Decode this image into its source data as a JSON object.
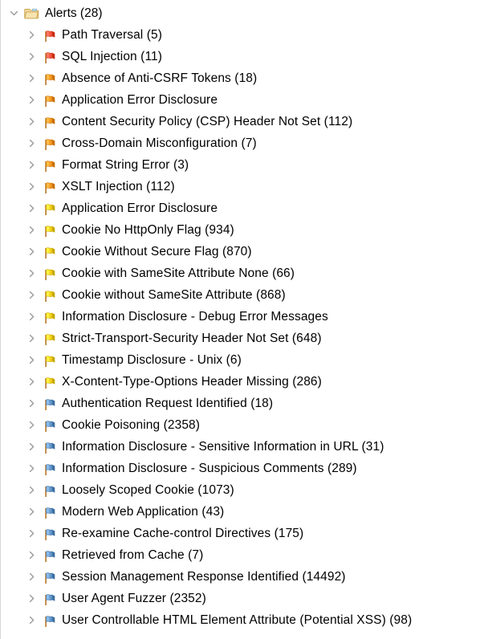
{
  "panel": {
    "name": "alerts-tree-panel",
    "background": "#ffffff"
  },
  "root": {
    "label": "Alerts (28)",
    "icon": "folder-icon",
    "expanded": true,
    "chevron": "chevron-down-icon"
  },
  "risk_colors": {
    "high": "#f4553d",
    "medium": "#f59a23",
    "low": "#f2d21e",
    "informational": "#6699cc"
  },
  "nodes": [
    {
      "label": "Path Traversal (5)",
      "risk": "high",
      "icon": "flag-icon-red",
      "chevron": "chevron-right-icon"
    },
    {
      "label": "SQL Injection (11)",
      "risk": "high",
      "icon": "flag-icon-red",
      "chevron": "chevron-right-icon"
    },
    {
      "label": "Absence of Anti-CSRF Tokens (18)",
      "risk": "medium",
      "icon": "flag-icon-orange",
      "chevron": "chevron-right-icon"
    },
    {
      "label": "Application Error Disclosure",
      "risk": "medium",
      "icon": "flag-icon-orange",
      "chevron": "chevron-right-icon"
    },
    {
      "label": "Content Security Policy (CSP) Header Not Set (112)",
      "risk": "medium",
      "icon": "flag-icon-orange",
      "chevron": "chevron-right-icon"
    },
    {
      "label": "Cross-Domain Misconfiguration (7)",
      "risk": "medium",
      "icon": "flag-icon-orange",
      "chevron": "chevron-right-icon"
    },
    {
      "label": "Format String Error (3)",
      "risk": "medium",
      "icon": "flag-icon-orange",
      "chevron": "chevron-right-icon"
    },
    {
      "label": "XSLT Injection (112)",
      "risk": "medium",
      "icon": "flag-icon-orange",
      "chevron": "chevron-right-icon"
    },
    {
      "label": "Application Error Disclosure",
      "risk": "low",
      "icon": "flag-icon-yellow",
      "chevron": "chevron-right-icon"
    },
    {
      "label": "Cookie No HttpOnly Flag (934)",
      "risk": "low",
      "icon": "flag-icon-yellow",
      "chevron": "chevron-right-icon"
    },
    {
      "label": "Cookie Without Secure Flag (870)",
      "risk": "low",
      "icon": "flag-icon-yellow",
      "chevron": "chevron-right-icon"
    },
    {
      "label": "Cookie with SameSite Attribute None (66)",
      "risk": "low",
      "icon": "flag-icon-yellow",
      "chevron": "chevron-right-icon"
    },
    {
      "label": "Cookie without SameSite Attribute (868)",
      "risk": "low",
      "icon": "flag-icon-yellow",
      "chevron": "chevron-right-icon"
    },
    {
      "label": "Information Disclosure - Debug Error Messages",
      "risk": "low",
      "icon": "flag-icon-yellow",
      "chevron": "chevron-right-icon"
    },
    {
      "label": "Strict-Transport-Security Header Not Set (648)",
      "risk": "low",
      "icon": "flag-icon-yellow",
      "chevron": "chevron-right-icon"
    },
    {
      "label": "Timestamp Disclosure - Unix (6)",
      "risk": "low",
      "icon": "flag-icon-yellow",
      "chevron": "chevron-right-icon"
    },
    {
      "label": "X-Content-Type-Options Header Missing (286)",
      "risk": "low",
      "icon": "flag-icon-yellow",
      "chevron": "chevron-right-icon"
    },
    {
      "label": "Authentication Request Identified (18)",
      "risk": "informational",
      "icon": "flag-icon-blue",
      "chevron": "chevron-right-icon"
    },
    {
      "label": "Cookie Poisoning (2358)",
      "risk": "informational",
      "icon": "flag-icon-blue",
      "chevron": "chevron-right-icon"
    },
    {
      "label": "Information Disclosure - Sensitive Information in URL (31)",
      "risk": "informational",
      "icon": "flag-icon-blue",
      "chevron": "chevron-right-icon"
    },
    {
      "label": "Information Disclosure - Suspicious Comments (289)",
      "risk": "informational",
      "icon": "flag-icon-blue",
      "chevron": "chevron-right-icon"
    },
    {
      "label": "Loosely Scoped Cookie (1073)",
      "risk": "informational",
      "icon": "flag-icon-blue",
      "chevron": "chevron-right-icon"
    },
    {
      "label": "Modern Web Application (43)",
      "risk": "informational",
      "icon": "flag-icon-blue",
      "chevron": "chevron-right-icon"
    },
    {
      "label": "Re-examine Cache-control Directives (175)",
      "risk": "informational",
      "icon": "flag-icon-blue",
      "chevron": "chevron-right-icon"
    },
    {
      "label": "Retrieved from Cache (7)",
      "risk": "informational",
      "icon": "flag-icon-blue",
      "chevron": "chevron-right-icon"
    },
    {
      "label": "Session Management Response Identified (14492)",
      "risk": "informational",
      "icon": "flag-icon-blue",
      "chevron": "chevron-right-icon"
    },
    {
      "label": "User Agent Fuzzer (2352)",
      "risk": "informational",
      "icon": "flag-icon-blue",
      "chevron": "chevron-right-icon"
    },
    {
      "label": "User Controllable HTML Element Attribute (Potential XSS) (98)",
      "risk": "informational",
      "icon": "flag-icon-blue",
      "chevron": "chevron-right-icon"
    }
  ]
}
